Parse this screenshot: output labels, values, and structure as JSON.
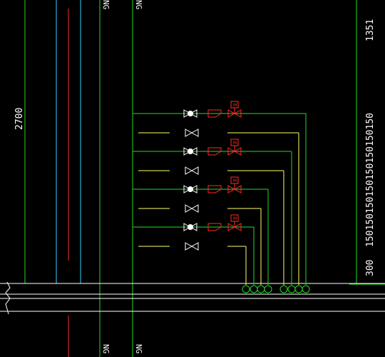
{
  "drawing": {
    "background": "#000000",
    "colors": {
      "green": "#22dd22",
      "white": "#ffffff",
      "red": "#ff2a2a",
      "cyan": "#33ccff",
      "yellow": "#ffff66"
    },
    "dimensions": {
      "left_height": "2700",
      "right_top": "1351",
      "right_stack": "150150150150150150150150",
      "right_bottom": "300"
    },
    "pipe_tags": {
      "top_a": "NG",
      "top_b": "NG",
      "bottom_a": "NG",
      "bottom_b": "NG"
    },
    "valve_marker_label": "M",
    "branches": [
      {
        "row": 1,
        "gas": true
      },
      {
        "row": 2,
        "gas": false
      },
      {
        "row": 3,
        "gas": true
      },
      {
        "row": 4,
        "gas": false
      },
      {
        "row": 5,
        "gas": true
      },
      {
        "row": 6,
        "gas": false
      },
      {
        "row": 7,
        "gas": true
      },
      {
        "row": 8,
        "gas": false
      }
    ],
    "header_connection_count": 8
  }
}
